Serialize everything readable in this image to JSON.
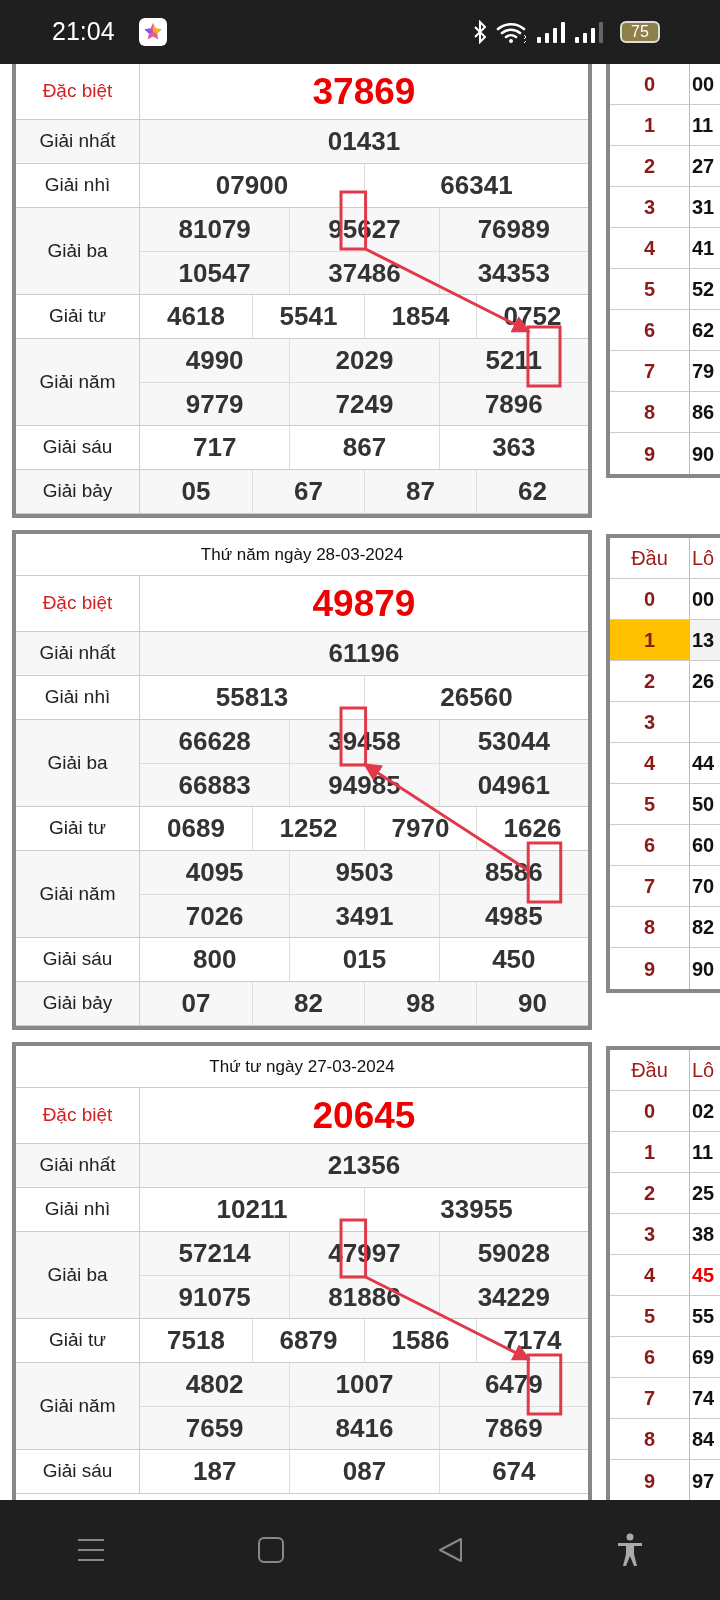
{
  "status_bar": {
    "time": "21:04",
    "battery": "75"
  },
  "blocks": [
    {
      "arrow_reversed": false,
      "prizes": [
        {
          "kind": "special",
          "label": "Đặc biệt",
          "numbers": [
            "37869"
          ]
        },
        {
          "kind": "regular",
          "label": "Giải nhất",
          "numbers": [
            "01431"
          ]
        },
        {
          "kind": "regular",
          "label": "Giải nhì",
          "numbers": [
            "07900",
            "66341"
          ]
        },
        {
          "kind": "regular",
          "label": "Giải ba",
          "numbers": [
            "81079",
            "95627",
            "76989",
            "10547",
            "37486",
            "34353"
          ]
        },
        {
          "kind": "regular",
          "label": "Giải tư",
          "numbers": [
            "4618",
            "5541",
            "1854",
            "0752"
          ]
        },
        {
          "kind": "regular",
          "label": "Giải năm",
          "numbers": [
            "4990",
            "2029",
            "5211",
            "9779",
            "7249",
            "7896"
          ]
        },
        {
          "kind": "regular",
          "label": "Giải sáu",
          "numbers": [
            "717",
            "867",
            "363"
          ]
        },
        {
          "kind": "regular",
          "label": "Giải bảy",
          "numbers": [
            "05",
            "67",
            "87",
            "62"
          ]
        }
      ],
      "loto": {
        "rows": [
          {
            "head": "0",
            "tail": "00",
            "marked": false,
            "special": false
          },
          {
            "head": "1",
            "tail": "11",
            "marked": false,
            "special": false
          },
          {
            "head": "2",
            "tail": "27",
            "marked": false,
            "special": false
          },
          {
            "head": "3",
            "tail": "31",
            "marked": false,
            "special": false
          },
          {
            "head": "4",
            "tail": "41",
            "marked": false,
            "special": false
          },
          {
            "head": "5",
            "tail": "52",
            "marked": false,
            "special": false
          },
          {
            "head": "6",
            "tail": "62",
            "marked": false,
            "special": false
          },
          {
            "head": "7",
            "tail": "79",
            "marked": false,
            "special": false
          },
          {
            "head": "8",
            "tail": "86",
            "marked": false,
            "special": false
          },
          {
            "head": "9",
            "tail": "90",
            "marked": false,
            "special": false
          }
        ]
      }
    },
    {
      "date": "Thứ năm ngày 28-03-2024",
      "arrow_reversed": true,
      "prizes": [
        {
          "kind": "special",
          "label": "Đặc biệt",
          "numbers": [
            "49879"
          ]
        },
        {
          "kind": "regular",
          "label": "Giải nhất",
          "numbers": [
            "61196"
          ]
        },
        {
          "kind": "regular",
          "label": "Giải nhì",
          "numbers": [
            "55813",
            "26560"
          ]
        },
        {
          "kind": "regular",
          "label": "Giải ba",
          "numbers": [
            "66628",
            "39458",
            "53044",
            "66883",
            "94985",
            "04961"
          ]
        },
        {
          "kind": "regular",
          "label": "Giải tư",
          "numbers": [
            "0689",
            "1252",
            "7970",
            "1626"
          ]
        },
        {
          "kind": "regular",
          "label": "Giải năm",
          "numbers": [
            "4095",
            "9503",
            "8586",
            "7026",
            "3491",
            "4985"
          ]
        },
        {
          "kind": "regular",
          "label": "Giải sáu",
          "numbers": [
            "800",
            "015",
            "450"
          ]
        },
        {
          "kind": "regular",
          "label": "Giải bảy",
          "numbers": [
            "07",
            "82",
            "98",
            "90"
          ]
        }
      ],
      "loto": {
        "columns": [
          "Đầu",
          "Lô"
        ],
        "rows": [
          {
            "head": "0",
            "tail": "00",
            "marked": false,
            "special": false
          },
          {
            "head": "1",
            "tail": "13",
            "marked": true,
            "special": false
          },
          {
            "head": "2",
            "tail": "26",
            "marked": false,
            "special": false
          },
          {
            "head": "3",
            "marked": false,
            "special": false
          },
          {
            "head": "4",
            "tail": "44",
            "marked": false,
            "special": false
          },
          {
            "head": "5",
            "tail": "50",
            "marked": false,
            "special": false
          },
          {
            "head": "6",
            "tail": "60",
            "marked": false,
            "special": false
          },
          {
            "head": "7",
            "tail": "70",
            "marked": false,
            "special": false
          },
          {
            "head": "8",
            "tail": "82",
            "marked": false,
            "special": false
          },
          {
            "head": "9",
            "tail": "90",
            "marked": false,
            "special": false
          }
        ]
      }
    },
    {
      "date": "Thứ tư ngày 27-03-2024",
      "arrow_reversed": false,
      "prizes": [
        {
          "kind": "special",
          "label": "Đặc biệt",
          "numbers": [
            "20645"
          ]
        },
        {
          "kind": "regular",
          "label": "Giải nhất",
          "numbers": [
            "21356"
          ]
        },
        {
          "kind": "regular",
          "label": "Giải nhì",
          "numbers": [
            "10211",
            "33955"
          ]
        },
        {
          "kind": "regular",
          "label": "Giải ba",
          "numbers": [
            "57214",
            "47997",
            "59028",
            "91075",
            "81886",
            "34229"
          ]
        },
        {
          "kind": "regular",
          "label": "Giải tư",
          "numbers": [
            "7518",
            "6879",
            "1586",
            "7174"
          ]
        },
        {
          "kind": "regular",
          "label": "Giải năm",
          "numbers": [
            "4802",
            "1007",
            "6479",
            "7659",
            "8416",
            "7869"
          ]
        },
        {
          "kind": "regular",
          "label": "Giải sáu",
          "numbers": [
            "187",
            "087",
            "674"
          ]
        }
      ],
      "loto": {
        "columns": [
          "Đầu",
          "Lô"
        ],
        "rows": [
          {
            "head": "0",
            "tail": "02",
            "marked": false,
            "special": false
          },
          {
            "head": "1",
            "tail": "11",
            "marked": false,
            "special": false
          },
          {
            "head": "2",
            "tail": "25",
            "marked": false,
            "special": false
          },
          {
            "head": "3",
            "tail": "38",
            "marked": false,
            "special": false
          },
          {
            "head": "4",
            "tail": "45",
            "marked": false,
            "special": true
          },
          {
            "head": "5",
            "tail": "55",
            "marked": false,
            "special": false
          },
          {
            "head": "6",
            "tail": "69",
            "marked": false,
            "special": false
          },
          {
            "head": "7",
            "tail": "74",
            "marked": false,
            "special": false
          },
          {
            "head": "8",
            "tail": "84",
            "marked": false,
            "special": false
          },
          {
            "head": "9",
            "tail": "97",
            "marked": false,
            "special": false
          }
        ]
      }
    }
  ]
}
